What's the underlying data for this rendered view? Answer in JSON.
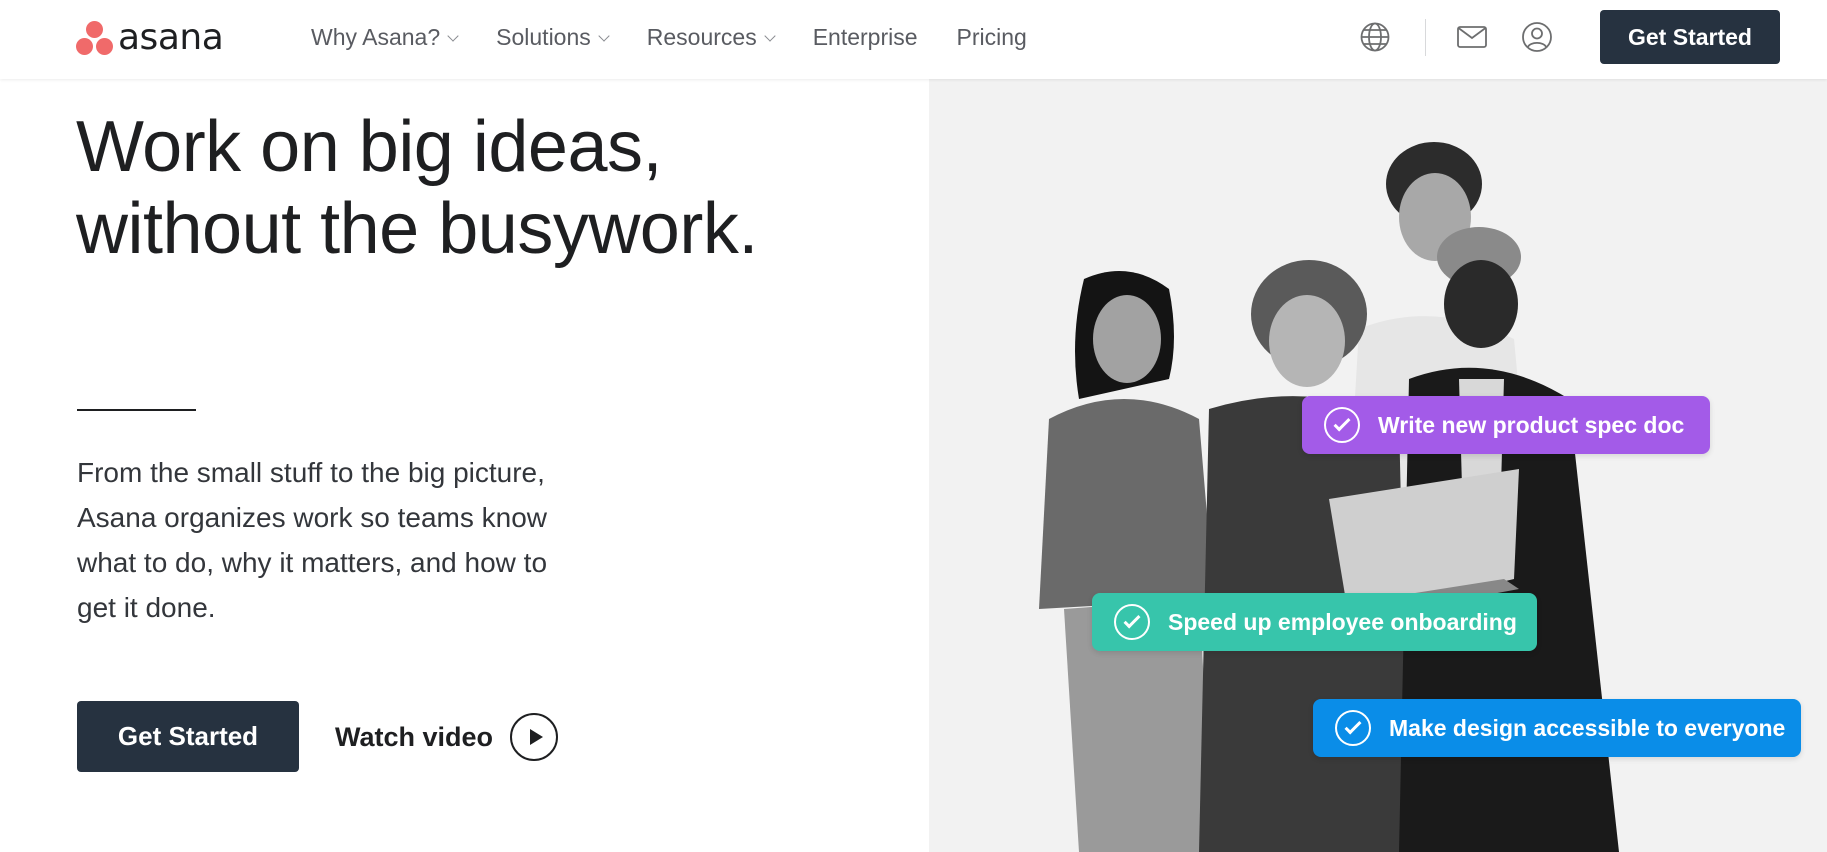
{
  "brand": {
    "name": "asana",
    "logo_color": "#f06a6a"
  },
  "nav": {
    "items": [
      {
        "label": "Why Asana?",
        "dropdown": true
      },
      {
        "label": "Solutions",
        "dropdown": true
      },
      {
        "label": "Resources",
        "dropdown": true
      },
      {
        "label": "Enterprise",
        "dropdown": false
      },
      {
        "label": "Pricing",
        "dropdown": false
      }
    ],
    "icons": [
      "globe-icon",
      "mail-icon",
      "user-icon"
    ],
    "cta_label": "Get Started"
  },
  "hero": {
    "headline_line1": "Work on big ideas,",
    "headline_line2": "without the busywork.",
    "body_lines": [
      "From the small stuff to the big picture,",
      "Asana organizes work so teams know",
      "what to do, why it matters, and how to",
      "get it done."
    ],
    "cta_primary": "Get Started",
    "cta_video": "Watch video"
  },
  "tasks": [
    {
      "label": "Write new product spec doc",
      "color": "#a35be8"
    },
    {
      "label": "Speed up employee onboarding",
      "color": "#37c5ab"
    },
    {
      "label": "Make design accessible to everyone",
      "color": "#0a8de8"
    }
  ],
  "colors": {
    "dark_button": "#263240",
    "panel_bg": "#f2f2f2"
  }
}
